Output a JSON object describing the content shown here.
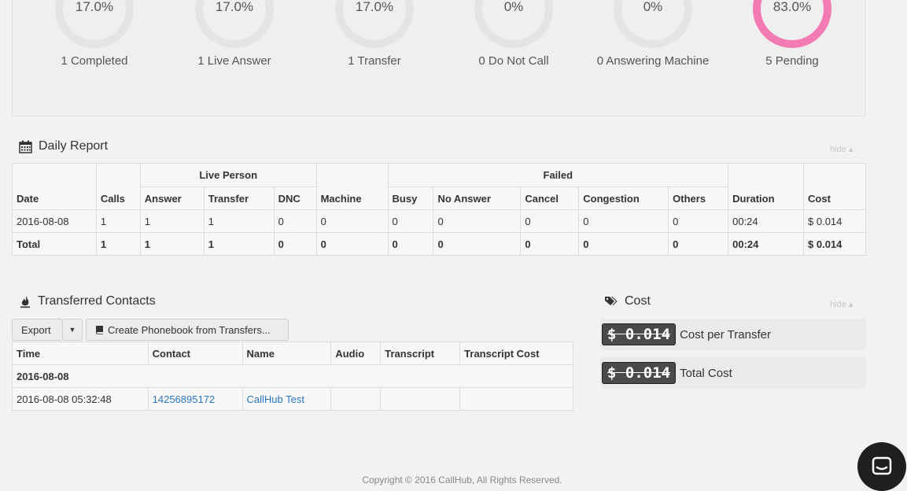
{
  "stats": [
    {
      "value": "17.0%",
      "label": "1 Completed",
      "highlight": false
    },
    {
      "value": "17.0%",
      "label": "1 Live Answer",
      "highlight": false
    },
    {
      "value": "17.0%",
      "label": "1 Transfer",
      "highlight": false
    },
    {
      "value": "0%",
      "label": "0 Do Not Call",
      "highlight": false
    },
    {
      "value": "0%",
      "label": "0 Answering Machine",
      "highlight": false
    },
    {
      "value": "83.0%",
      "label": "5 Pending",
      "highlight": true
    }
  ],
  "daily_report": {
    "title": "Daily Report",
    "hide_label": "hide",
    "group_headers": {
      "live_person": "Live Person",
      "failed": "Failed"
    },
    "columns": {
      "date": "Date",
      "calls": "Calls",
      "answer": "Answer",
      "transfer": "Transfer",
      "dnc": "DNC",
      "machine": "Machine",
      "busy": "Busy",
      "no_answer": "No Answer",
      "cancel": "Cancel",
      "congestion": "Congestion",
      "others": "Others",
      "duration": "Duration",
      "cost": "Cost"
    },
    "rows": [
      [
        "2016-08-08",
        "1",
        "1",
        "1",
        "0",
        "0",
        "0",
        "0",
        "0",
        "0",
        "0",
        "00:24",
        "$ 0.014"
      ]
    ],
    "total": [
      "Total",
      "1",
      "1",
      "1",
      "0",
      "0",
      "0",
      "0",
      "0",
      "0",
      "0",
      "00:24",
      "$ 0.014"
    ]
  },
  "transferred": {
    "title": "Transferred Contacts",
    "export_label": "Export",
    "create_phonebook_label": "Create Phonebook from Transfers...",
    "columns": {
      "time": "Time",
      "contact": "Contact",
      "name": "Name",
      "audio": "Audio",
      "transcript": "Transcript",
      "transcript_cost": "Transcript Cost"
    },
    "group_date": "2016-08-08",
    "rows": [
      {
        "time": "2016-08-08 05:32:48",
        "contact": "14256895172",
        "name": "CallHub Test",
        "audio": "",
        "transcript": "",
        "transcript_cost": ""
      }
    ]
  },
  "cost": {
    "title": "Cost",
    "hide_label": "hide",
    "per_transfer": {
      "amount": "$ 0.014",
      "label": "Cost per Transfer"
    },
    "total": {
      "amount": "$ 0.014",
      "label": "Total Cost"
    }
  },
  "footer": "Copyright © 2016 CallHub, All Rights Reserved.",
  "colors": {
    "pending_ring": "#f47ab4",
    "ring": "#e4e4e4",
    "link": "#2a77c2"
  }
}
